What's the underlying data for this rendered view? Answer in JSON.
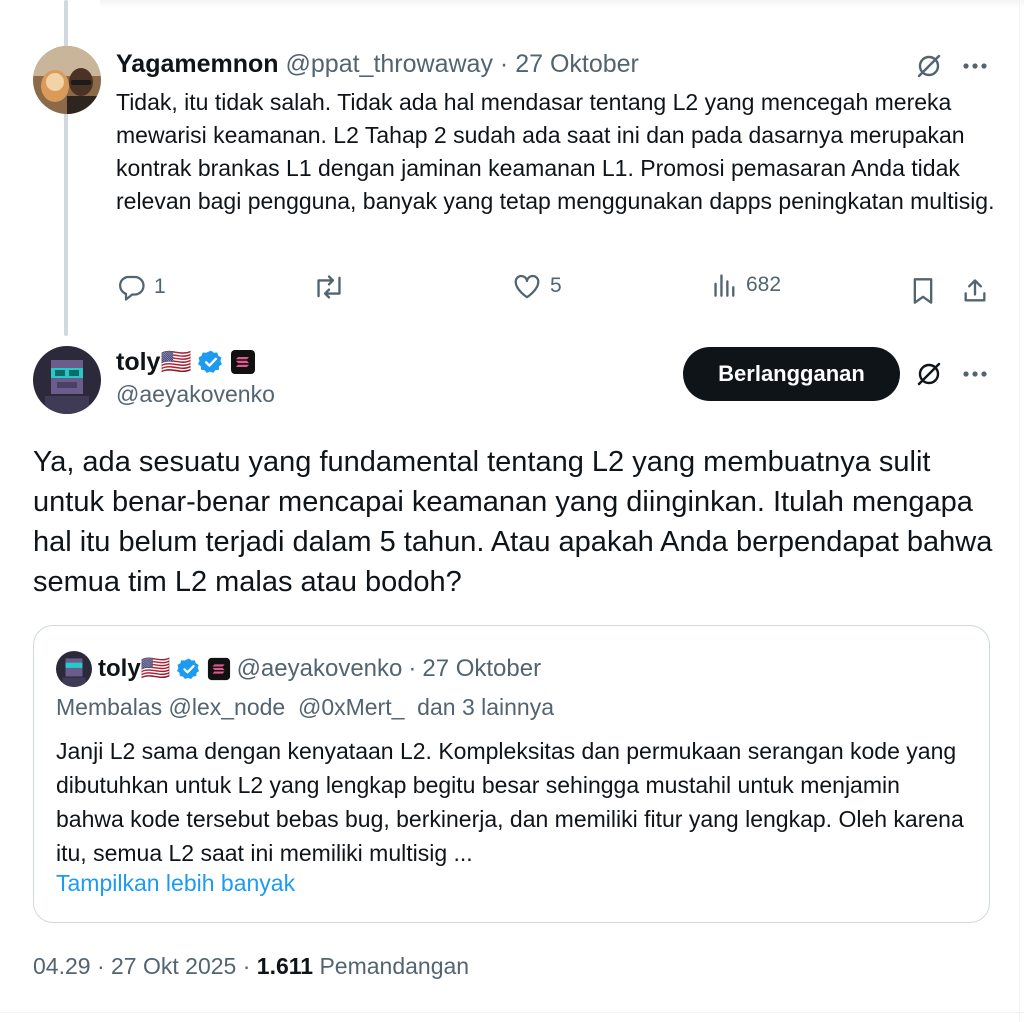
{
  "reply": {
    "name": "Yagamemnon",
    "handle": "@ppat_throwaway",
    "separator": "·",
    "date": "27 Oktober",
    "text": "Tidak, itu tidak salah. Tidak ada hal mendasar tentang L2 yang mencegah mereka mewarisi keamanan. L2 Tahap 2 sudah ada saat ini dan pada dasarnya merupakan kontrak brankas L1 dengan jaminan keamanan L1. Promosi pemasaran Anda tidak relevan bagi pengguna, banyak yang tetap menggunakan dapps peningkatan multisig.",
    "actions": {
      "replies": "1",
      "reposts": "",
      "likes": "5",
      "views": "682"
    }
  },
  "main": {
    "name": "toly",
    "flag": "🇺🇸",
    "handle": "@aeyakovenko",
    "subscribe_label": "Berlangganan",
    "text": "Ya, ada sesuatu yang fundamental tentang L2 yang membuatnya sulit untuk benar-benar mencapai keamanan yang diinginkan. Itulah mengapa hal itu belum terjadi dalam 5 tahun. Atau apakah Anda berpendapat bahwa semua tim L2 malas atau bodoh?"
  },
  "quote": {
    "name": "toly",
    "flag": "🇺🇸",
    "handle": "@aeyakovenko",
    "separator": "·",
    "date": "27 Oktober",
    "reply_to": "Membalas @lex_node  @0xMert_  dan 3 lainnya",
    "text": "Janji L2 sama dengan kenyataan L2. Kompleksitas dan permukaan serangan kode yang dibutuhkan untuk L2 yang lengkap begitu besar sehingga mustahil untuk menjamin bahwa kode tersebut bebas bug, berkinerja, dan memiliki fitur yang lengkap. Oleh karena itu, semua L2 saat ini memiliki multisig ...",
    "show_more": "Tampilkan lebih banyak"
  },
  "meta": {
    "time": "04.29",
    "sep1": "·",
    "date": "27 Okt 2025",
    "sep2": "·",
    "views_count": "1.611",
    "views_label": "Pemandangan"
  },
  "colors": {
    "text": "#0f1419",
    "muted": "#536471",
    "link": "#1d9bf0",
    "verified": "#1d9bf0",
    "button_bg": "#0f1419"
  },
  "icons": {
    "grok": "grok-icon",
    "more": "more-icon",
    "reply": "reply-icon",
    "repost": "repost-icon",
    "like": "like-icon",
    "views": "views-icon",
    "bookmark": "bookmark-icon",
    "share": "share-icon",
    "verified": "verified-badge-icon",
    "solana": "solana-badge-icon"
  }
}
